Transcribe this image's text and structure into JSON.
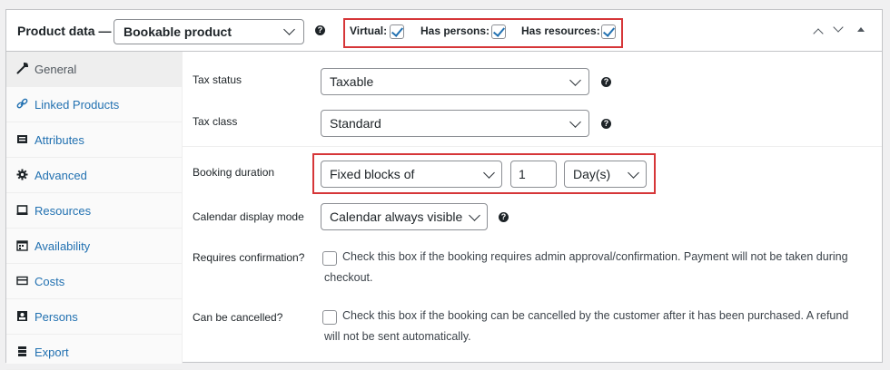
{
  "header": {
    "title": "Product data —",
    "product_type": "Bookable product",
    "options": {
      "virtual_label": "Virtual:",
      "persons_label": "Has persons:",
      "resources_label": "Has resources:"
    }
  },
  "sidebar": {
    "items": [
      {
        "label": "General",
        "icon": "wrench-icon"
      },
      {
        "label": "Linked Products",
        "icon": "link-icon"
      },
      {
        "label": "Attributes",
        "icon": "list-icon"
      },
      {
        "label": "Advanced",
        "icon": "gear-icon"
      },
      {
        "label": "Resources",
        "icon": "box-icon"
      },
      {
        "label": "Availability",
        "icon": "calendar-icon"
      },
      {
        "label": "Costs",
        "icon": "card-icon"
      },
      {
        "label": "Persons",
        "icon": "person-icon"
      },
      {
        "label": "Export",
        "icon": "stack-icon"
      }
    ]
  },
  "fields": {
    "tax_status": {
      "label": "Tax status",
      "value": "Taxable"
    },
    "tax_class": {
      "label": "Tax class",
      "value": "Standard"
    },
    "booking_duration": {
      "label": "Booking duration",
      "type": "Fixed blocks of",
      "amount": "1",
      "unit": "Day(s)"
    },
    "calendar_mode": {
      "label": "Calendar display mode",
      "value": "Calendar always visible"
    },
    "requires_confirmation": {
      "label": "Requires confirmation?",
      "text": "Check this box if the booking requires admin approval/confirmation. Payment will not be taken during checkout."
    },
    "can_be_cancelled": {
      "label": "Can be cancelled?",
      "text": "Check this box if the booking can be cancelled by the customer after it has been purchased. A refund will not be sent automatically."
    }
  },
  "colors": {
    "highlight": "#d63638",
    "accent": "#2271b1"
  }
}
